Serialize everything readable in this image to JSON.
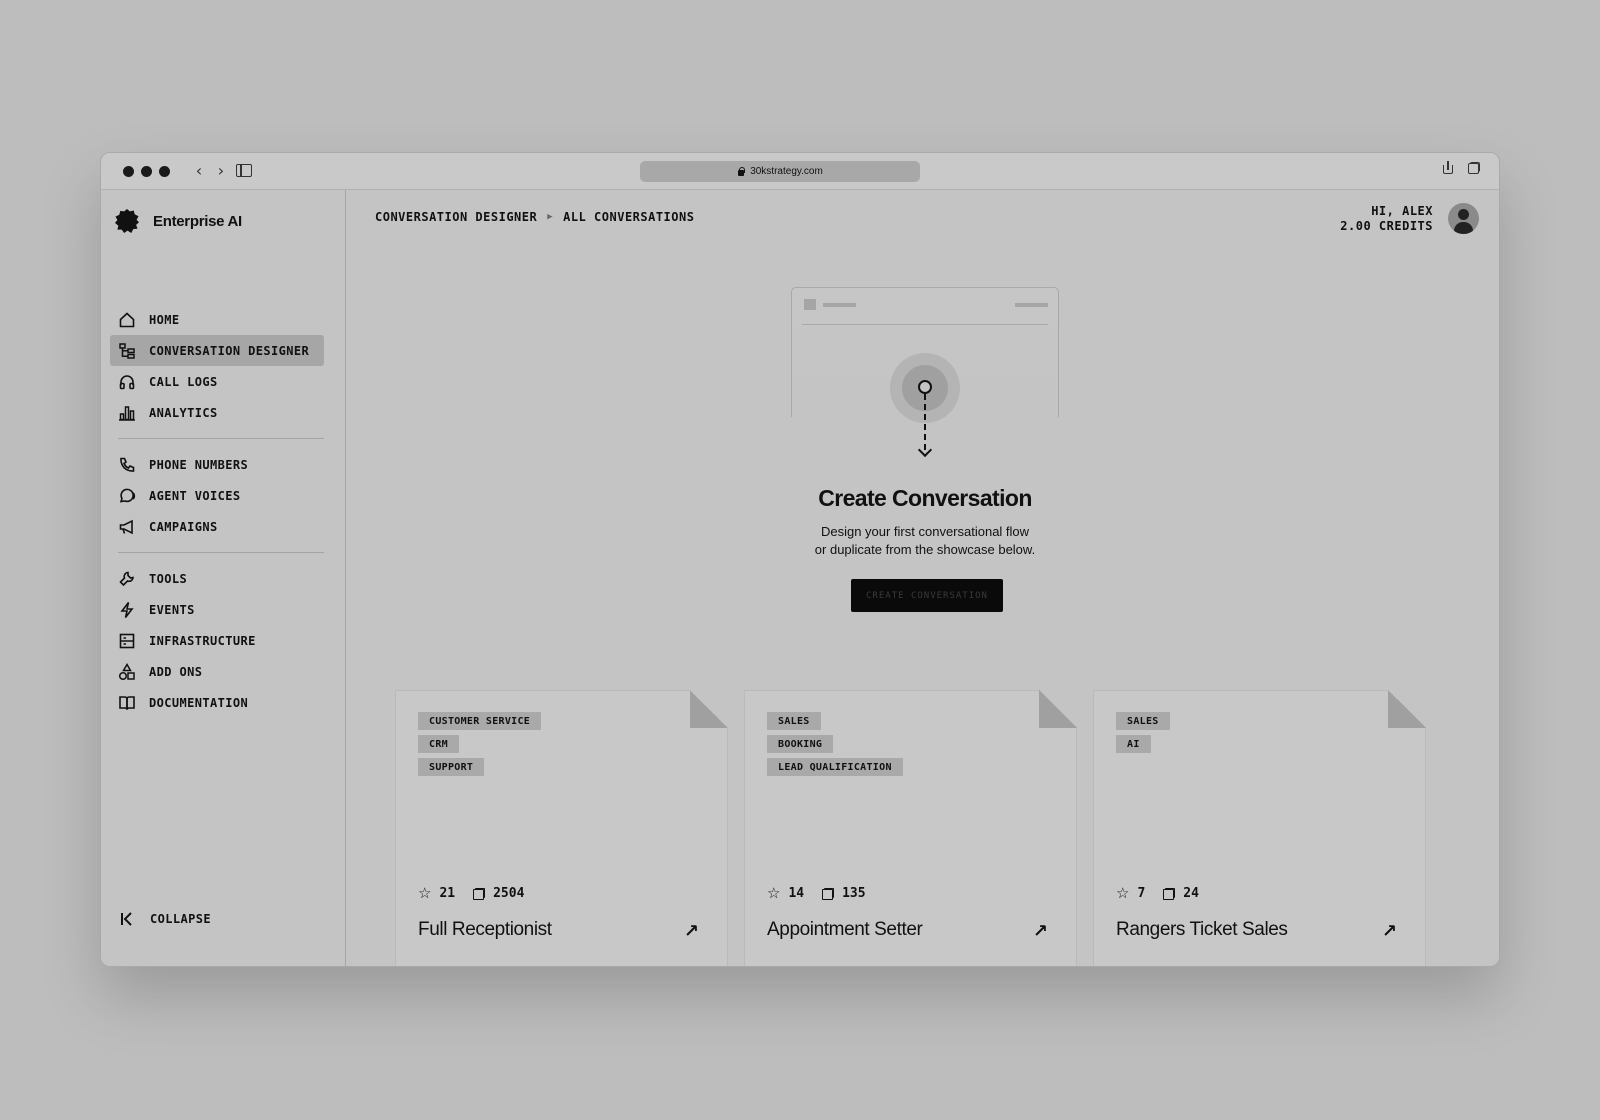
{
  "browser": {
    "url": "30kstrategy.com"
  },
  "brand": {
    "name": "Enterprise AI"
  },
  "sidebar": {
    "groups": [
      [
        {
          "label": "HOME",
          "icon": "home-icon"
        },
        {
          "label": "CONVERSATION DESIGNER",
          "icon": "flow-icon",
          "active": true
        },
        {
          "label": "CALL LOGS",
          "icon": "headphones-icon"
        },
        {
          "label": "ANALYTICS",
          "icon": "bar-chart-icon"
        }
      ],
      [
        {
          "label": "PHONE NUMBERS",
          "icon": "phone-icon"
        },
        {
          "label": "AGENT VOICES",
          "icon": "voice-icon"
        },
        {
          "label": "CAMPAIGNS",
          "icon": "megaphone-icon"
        }
      ],
      [
        {
          "label": "TOOLS",
          "icon": "wrench-icon"
        },
        {
          "label": "EVENTS",
          "icon": "bolt-icon"
        },
        {
          "label": "INFRASTRUCTURE",
          "icon": "server-icon"
        },
        {
          "label": "ADD ONS",
          "icon": "shapes-icon"
        },
        {
          "label": "DOCUMENTATION",
          "icon": "book-icon"
        }
      ]
    ],
    "collapse_label": "COLLAPSE"
  },
  "breadcrumb": {
    "items": [
      "CONVERSATION DESIGNER",
      "ALL CONVERSATIONS"
    ]
  },
  "user": {
    "greeting": "HI, ALEX",
    "credits": "2.00 CREDITS"
  },
  "hero": {
    "title": "Create Conversation",
    "subtitle_line1": "Design your first conversational flow",
    "subtitle_line2": "or duplicate from the showcase below.",
    "button_label": "CREATE CONVERSATION"
  },
  "cards": [
    {
      "tags": [
        "CUSTOMER SERVICE",
        "CRM",
        "SUPPORT"
      ],
      "stars": "21",
      "copies": "2504",
      "title": "Full Receptionist"
    },
    {
      "tags": [
        "SALES",
        "BOOKING",
        "LEAD QUALIFICATION"
      ],
      "stars": "14",
      "copies": "135",
      "title": "Appointment Setter"
    },
    {
      "tags": [
        "SALES",
        "AI"
      ],
      "stars": "7",
      "copies": "24",
      "title": "Rangers Ticket Sales"
    }
  ]
}
